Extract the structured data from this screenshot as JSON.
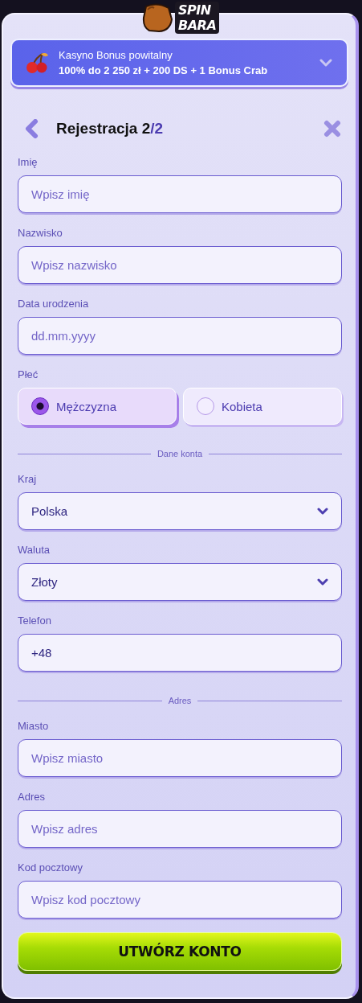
{
  "logo": {
    "lines": [
      "SPIN",
      "BARA"
    ]
  },
  "bonus": {
    "title": "Kasyno Bonus powitalny",
    "offer": "100% do 2 250 zł + 200 DS + 1 Bonus Crab"
  },
  "header": {
    "title": "Rejestracja 2",
    "step": "/2"
  },
  "form": [
    {
      "kind": "field",
      "label": "Imię",
      "placeholder": "Wpisz imię"
    },
    {
      "kind": "field",
      "label": "Nazwisko",
      "placeholder": "Wpisz nazwisko"
    },
    {
      "kind": "field",
      "label": "Data urodzenia",
      "placeholder": "dd.mm.yyyy"
    },
    {
      "kind": "radio",
      "label": "Płeć",
      "options": [
        {
          "label": "Mężczyzna",
          "selected": true
        },
        {
          "label": "Kobieta",
          "selected": false
        }
      ]
    },
    {
      "kind": "divider",
      "label": "Dane konta"
    },
    {
      "kind": "select",
      "label": "Kraj",
      "value": "Polska"
    },
    {
      "kind": "select",
      "label": "Waluta",
      "value": "Złoty"
    },
    {
      "kind": "field",
      "label": "Telefon",
      "value": "+48"
    },
    {
      "kind": "divider",
      "label": "Adres"
    },
    {
      "kind": "field",
      "label": "Miasto",
      "placeholder": "Wpisz miasto"
    },
    {
      "kind": "field",
      "label": "Adres",
      "placeholder": "Wpisz adres"
    },
    {
      "kind": "field",
      "label": "Kod pocztowy",
      "placeholder": "Wpisz kod pocztowy"
    }
  ],
  "submit": "UTWÓRZ KONTO"
}
